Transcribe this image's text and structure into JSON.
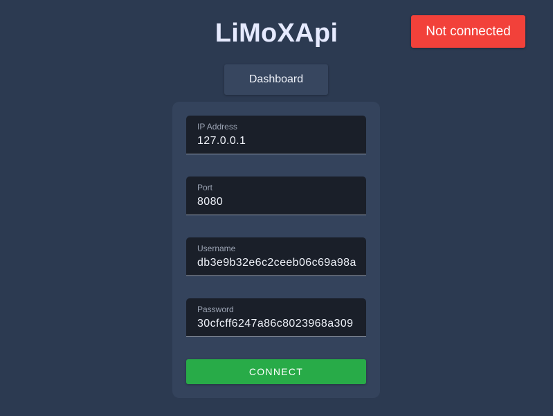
{
  "app": {
    "title": "LiMoXApi"
  },
  "status": {
    "label": "Not connected",
    "color": "#f2413a"
  },
  "nav": {
    "dashboard_label": "Dashboard"
  },
  "form": {
    "fields": [
      {
        "label": "IP Address",
        "value": "127.0.0.1"
      },
      {
        "label": "Port",
        "value": "8080"
      },
      {
        "label": "Username",
        "value": "db3e9b32e6c2ceeb06c69a98a"
      },
      {
        "label": "Password",
        "value": "30cfcff6247a86c8023968a309"
      }
    ],
    "connect_label": "CONNECT",
    "connect_color": "#28ab48"
  },
  "theme": {
    "background": "#2c3a51",
    "card": "#34435c",
    "input": "#1a1f29"
  }
}
